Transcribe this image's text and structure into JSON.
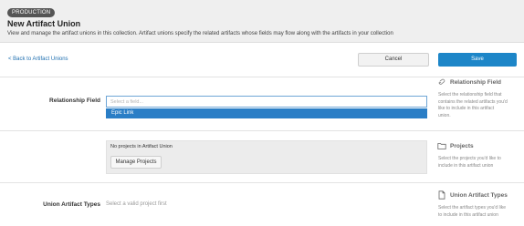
{
  "header": {
    "env_badge": "PRODUCTION",
    "title": "New Artifact Union",
    "description": "View and manage the artifact unions in this collection. Artifact unions specify the related artifacts whose fields may flow along with the artifacts in your collection"
  },
  "toolbar": {
    "back_label": "< Back to Artifact Unions",
    "cancel_label": "Cancel",
    "save_label": "Save"
  },
  "relationship": {
    "label": "Relationship Field",
    "placeholder": "Select a field...",
    "options": [
      "Epic Link"
    ]
  },
  "projects": {
    "empty_message": "No projects in Artifact Union",
    "manage_label": "Manage Projects"
  },
  "union_types": {
    "label": "Union Artifact Types",
    "hint": "Select a valid project first"
  },
  "help": {
    "relationship": {
      "title": "Relationship Field",
      "lines": [
        "Select the relationship field that",
        "contains the related artifacts you'd",
        "like to include in this artifact",
        "union."
      ]
    },
    "projects": {
      "title": "Projects",
      "lines": [
        "Select the projects you'd like to",
        "include in this artifact union"
      ]
    },
    "types": {
      "title": "Union Artifact Types",
      "lines": [
        "Select the artifact types you'd like",
        "to include in this artifact union"
      ]
    }
  },
  "colors": {
    "accent": "#1d86c8",
    "selected_option": "#2a7ec6",
    "link": "#1f6fb0"
  }
}
